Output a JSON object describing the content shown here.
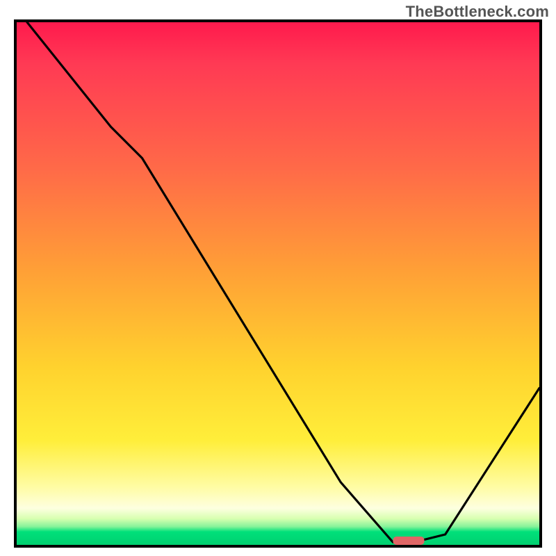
{
  "watermark": "TheBottleneck.com",
  "chart_data": {
    "type": "line",
    "title": "",
    "xlabel": "",
    "ylabel": "",
    "xlim": [
      0,
      100
    ],
    "ylim": [
      0,
      100
    ],
    "background": "red-orange-yellow-green vertical gradient",
    "series": [
      {
        "name": "bottleneck-curve",
        "x": [
          2,
          18,
          24,
          62,
          72,
          76,
          82,
          100
        ],
        "y": [
          100,
          80,
          74,
          12,
          0.5,
          0.5,
          2,
          30
        ]
      }
    ],
    "marker": {
      "name": "optimal-segment-marker",
      "x_range": [
        72,
        78
      ],
      "y": 0.8,
      "color": "#e06666"
    }
  }
}
